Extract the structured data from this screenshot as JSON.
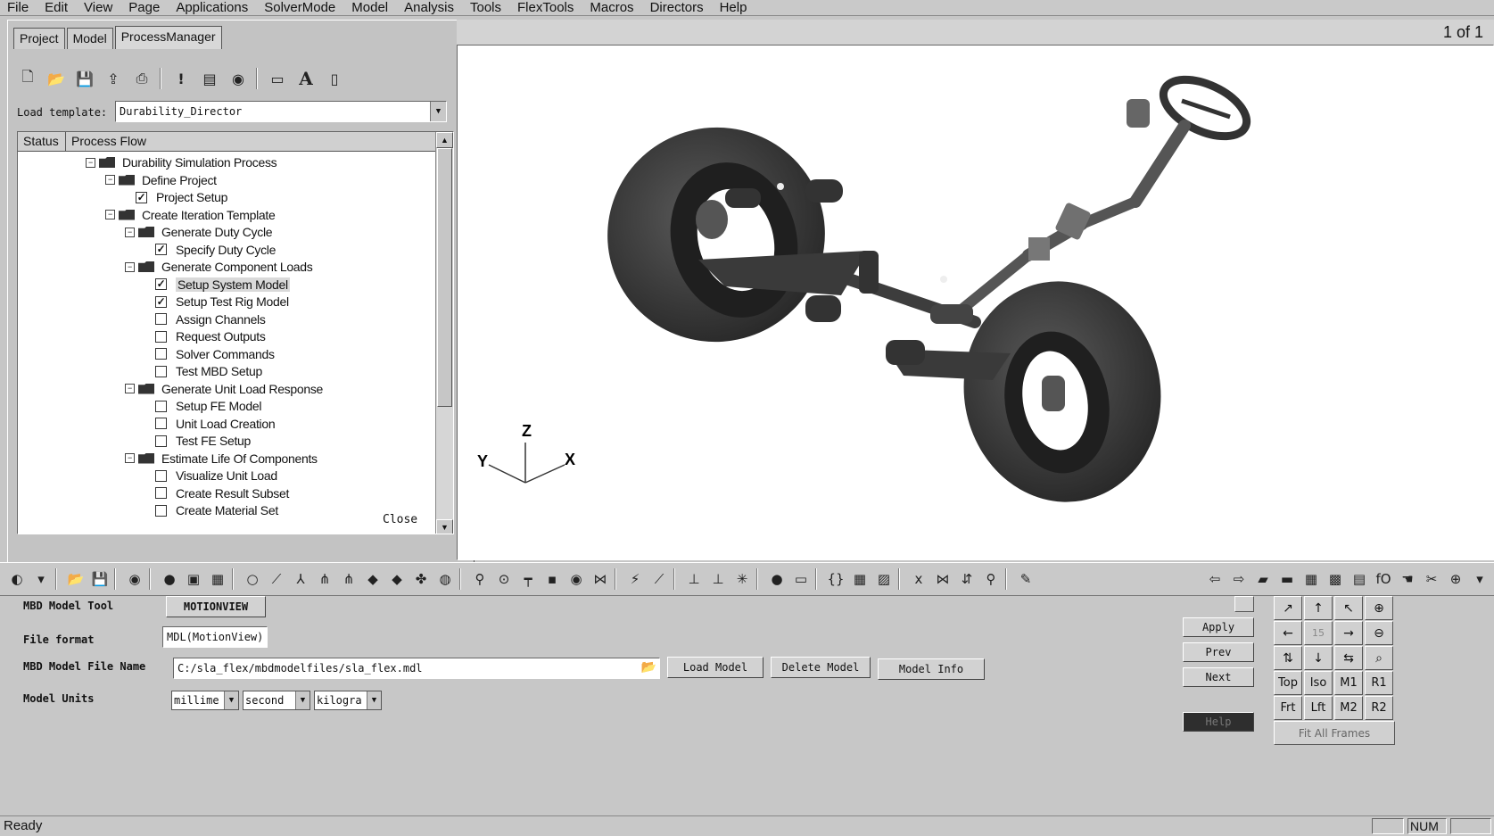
{
  "menu": [
    "File",
    "Edit",
    "View",
    "Page",
    "Applications",
    "SolverMode",
    "Model",
    "Analysis",
    "Tools",
    "FlexTools",
    "Macros",
    "Directors",
    "Help"
  ],
  "tabs": [
    "Project",
    "Model",
    "ProcessManager"
  ],
  "load_template": {
    "label": "Load template:",
    "value": "Durability_Director"
  },
  "tree": {
    "headers": [
      "Status",
      "Process Flow"
    ],
    "rows": [
      {
        "label": "Durability Simulation Process",
        "kind": "folder"
      },
      {
        "label": "Define Project",
        "kind": "folder"
      },
      {
        "label": "Project Setup",
        "kind": "checked"
      },
      {
        "label": "Create Iteration Template",
        "kind": "folder"
      },
      {
        "label": "Generate Duty Cycle",
        "kind": "folder"
      },
      {
        "label": "Specify Duty Cycle",
        "kind": "checked"
      },
      {
        "label": "Generate Component Loads",
        "kind": "folder"
      },
      {
        "label": "Setup System Model",
        "kind": "partial"
      },
      {
        "label": "Setup Test Rig Model",
        "kind": "partial"
      },
      {
        "label": "Assign Channels",
        "kind": "box"
      },
      {
        "label": "Request Outputs",
        "kind": "box"
      },
      {
        "label": "Solver Commands",
        "kind": "box"
      },
      {
        "label": "Test MBD Setup",
        "kind": "box"
      },
      {
        "label": "Generate Unit Load Response",
        "kind": "folder"
      },
      {
        "label": "Setup FE Model",
        "kind": "box"
      },
      {
        "label": "Unit Load Creation",
        "kind": "box"
      },
      {
        "label": "Test FE Setup",
        "kind": "box"
      },
      {
        "label": "Estimate Life Of Components",
        "kind": "folder"
      },
      {
        "label": "Visualize Unit Load",
        "kind": "box"
      },
      {
        "label": "Create Result Subset",
        "kind": "box"
      },
      {
        "label": "Create Material Set",
        "kind": "box"
      }
    ]
  },
  "close_label": "Close",
  "page_indicator": "1 of 1",
  "axes": {
    "z": "Z",
    "y": "Y",
    "x": "X"
  },
  "form": {
    "mbd_tool_label": "MBD Model Tool",
    "mbd_tool_value": "MOTIONVIEW",
    "file_format_label": "File format",
    "file_format_value": "MDL(MotionView)",
    "file_name_label": "MBD Model File Name",
    "file_name_value": "C:/sla_flex/mbdmodelfiles/sla_flex.mdl",
    "units_label": "Model Units",
    "units": [
      "millime",
      "second",
      "kilogra"
    ],
    "load_model": "Load Model",
    "delete_model": "Delete Model",
    "model_info": "Model Info",
    "apply": "Apply",
    "prev": "Prev",
    "next": "Next",
    "help": "Help"
  },
  "view_controls": {
    "zoom_value": "15",
    "views": [
      "Top",
      "Iso",
      "M1",
      "R1",
      "Frt",
      "Lft",
      "M2",
      "R2"
    ],
    "fit_all": "Fit All Frames"
  },
  "status": {
    "text": "Ready",
    "num": "NUM"
  }
}
